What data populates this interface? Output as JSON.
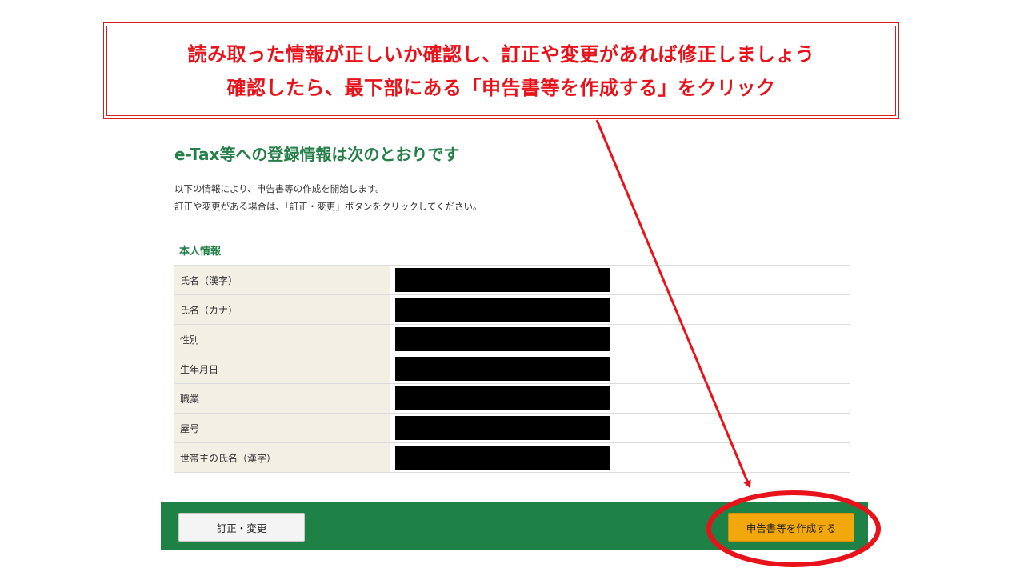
{
  "callout": {
    "line1": "読み取った情報が正しいか確認し、訂正や変更があれば修正しましょう",
    "line2": "確認したら、最下部にある「申告書等を作成する」をクリック"
  },
  "page": {
    "title": "e-Tax等への登録情報は次のとおりです",
    "intro": [
      "以下の情報により、申告書等の作成を開始します。",
      "訂正や変更がある場合は、「訂正・変更」ボタンをクリックしてください。"
    ]
  },
  "personal_info": {
    "section_title": "本人情報",
    "rows": [
      {
        "label": "氏名（漢字）",
        "value_redacted": true
      },
      {
        "label": "氏名（カナ）",
        "value_redacted": true
      },
      {
        "label": "性別",
        "value_redacted": true
      },
      {
        "label": "生年月日",
        "value_redacted": true
      },
      {
        "label": "職業",
        "value_redacted": true
      },
      {
        "label": "屋号",
        "value_redacted": true
      },
      {
        "label": "世帯主の氏名（漢字）",
        "value_redacted": true
      }
    ]
  },
  "actions": {
    "correct_label": "訂正・変更",
    "create_label": "申告書等を作成する"
  },
  "colors": {
    "accent_green": "#1e8247",
    "title_green": "#247f48",
    "annotation_red": "#e8121a",
    "create_button": "#f2a80b",
    "label_background": "#f2efe5"
  }
}
